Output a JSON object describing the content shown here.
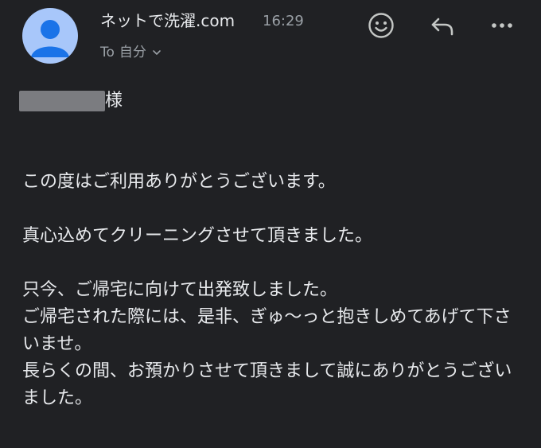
{
  "sender": {
    "name": "ネットで洗濯.com",
    "time": "16:29",
    "recipient_prefix": "To",
    "recipient_name": "自分"
  },
  "icons": {
    "avatar": "person-avatar",
    "emoji": "smiley-icon",
    "reply": "reply-icon",
    "more": "more-horizontal-icon",
    "recipient_expand": "chevron-down-icon"
  },
  "colors": {
    "background": "#202124",
    "text": "#e8eaed",
    "muted": "#9aa0a6",
    "avatar_bg": "#a8c7fa",
    "avatar_fg": "#1a73e8"
  },
  "message": {
    "salutation_suffix": "様",
    "p1": "この度はご利用ありがとうございます。",
    "p2": "真心込めてクリーニングさせて頂きました。",
    "p3_line1": "只今、ご帰宅に向けて出発致しました。",
    "p3_line2": "ご帰宅された際には、是非、ぎゅ〜っと抱きしめてあげて下さいませ。",
    "p3_line3": "長らくの間、お預かりさせて頂きまして誠にありがとうございました。"
  }
}
